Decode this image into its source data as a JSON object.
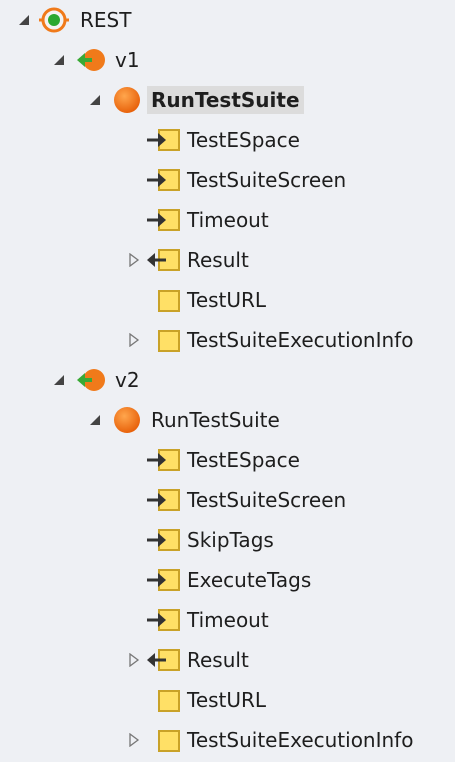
{
  "tree": {
    "root": {
      "label": "REST",
      "expanded": true,
      "icon": "rest-service-icon",
      "versions": [
        {
          "label": "v1",
          "expanded": true,
          "icon": "rest-version-icon",
          "method": {
            "label": "RunTestSuite",
            "expanded": true,
            "selected": true,
            "icon": "method-orange-circle-icon",
            "params": [
              {
                "label": "TestESpace",
                "kind": "input",
                "icon": "input-parameter-icon",
                "expandable": false
              },
              {
                "label": "TestSuiteScreen",
                "kind": "input",
                "icon": "input-parameter-icon",
                "expandable": false
              },
              {
                "label": "Timeout",
                "kind": "input",
                "icon": "input-parameter-icon",
                "expandable": false
              },
              {
                "label": "Result",
                "kind": "output",
                "icon": "output-parameter-icon",
                "expandable": true
              },
              {
                "label": "TestURL",
                "kind": "local",
                "icon": "local-variable-icon",
                "expandable": false
              },
              {
                "label": "TestSuiteExecutionInfo",
                "kind": "local",
                "icon": "local-variable-icon",
                "expandable": true
              }
            ]
          }
        },
        {
          "label": "v2",
          "expanded": true,
          "icon": "rest-version-icon",
          "method": {
            "label": "RunTestSuite",
            "expanded": true,
            "selected": false,
            "icon": "method-orange-circle-icon",
            "params": [
              {
                "label": "TestESpace",
                "kind": "input",
                "icon": "input-parameter-icon",
                "expandable": false
              },
              {
                "label": "TestSuiteScreen",
                "kind": "input",
                "icon": "input-parameter-icon",
                "expandable": false
              },
              {
                "label": "SkipTags",
                "kind": "input",
                "icon": "input-parameter-icon",
                "expandable": false
              },
              {
                "label": "ExecuteTags",
                "kind": "input",
                "icon": "input-parameter-icon",
                "expandable": false
              },
              {
                "label": "Timeout",
                "kind": "input",
                "icon": "input-parameter-icon",
                "expandable": false
              },
              {
                "label": "Result",
                "kind": "output",
                "icon": "output-parameter-icon",
                "expandable": true
              },
              {
                "label": "TestURL",
                "kind": "local",
                "icon": "local-variable-icon",
                "expandable": false
              },
              {
                "label": "TestSuiteExecutionInfo",
                "kind": "local",
                "icon": "local-variable-icon",
                "expandable": true
              }
            ]
          }
        }
      ]
    }
  },
  "colors": {
    "background": "#eef0f4",
    "selection": "#dcdcdc",
    "method_orange": "#f07a1a",
    "param_yellow": "#ffe066",
    "param_border": "#c9a227",
    "arrow_green": "#3aa935",
    "arrow_dark": "#333333"
  }
}
